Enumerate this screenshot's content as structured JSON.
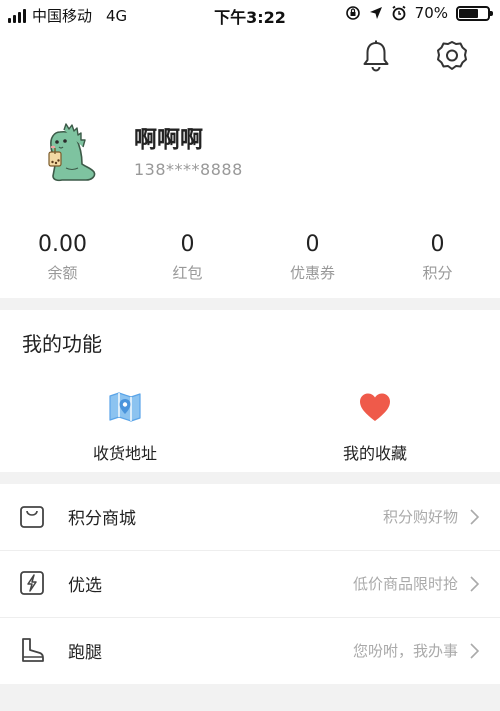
{
  "status_bar": {
    "carrier": "中国移动",
    "network": "4G",
    "time": "下午3:22",
    "battery": "70%",
    "battery_level": 0.7
  },
  "header": {
    "icons": [
      "bell-icon",
      "settings-gear-icon"
    ]
  },
  "profile": {
    "name": "啊啊啊",
    "phone": "138****8888",
    "avatar": "green-dinosaur-avatar"
  },
  "stats": [
    {
      "value": "0.00",
      "label": "余额"
    },
    {
      "value": "0",
      "label": "红包"
    },
    {
      "value": "0",
      "label": "优惠券"
    },
    {
      "value": "0",
      "label": "积分"
    }
  ],
  "functions": {
    "title": "我的功能",
    "items": [
      {
        "label": "收货地址",
        "icon": "map-pin-icon",
        "color": "#5aa4e8"
      },
      {
        "label": "我的收藏",
        "icon": "heart-icon",
        "color": "#ef5a4a"
      }
    ]
  },
  "menu": [
    {
      "label": "积分商城",
      "hint": "积分购好物",
      "icon": "shopping-bag-icon"
    },
    {
      "label": "优选",
      "hint": "低价商品限时抢",
      "icon": "lightning-icon"
    },
    {
      "label": "跑腿",
      "hint": "您吩咐，我办事",
      "icon": "boot-icon"
    }
  ],
  "colors": {
    "separator": "#f2f2f2",
    "hint_text": "#aaaaaa",
    "label_text": "#999999"
  }
}
